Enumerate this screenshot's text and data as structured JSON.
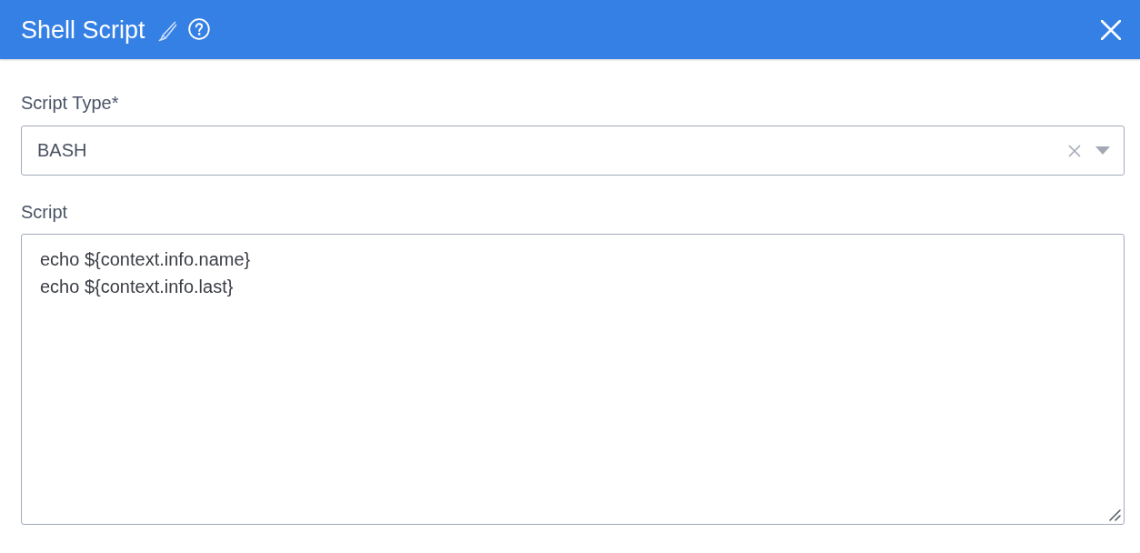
{
  "dialog": {
    "title": "Shell Script"
  },
  "fields": [
    {
      "kind": "select",
      "label": "Script Type*",
      "value": "BASH"
    },
    {
      "kind": "textarea",
      "label": "Script",
      "lines": [
        "echo ${context.info.name}",
        "echo ${context.info.last}"
      ]
    }
  ]
}
